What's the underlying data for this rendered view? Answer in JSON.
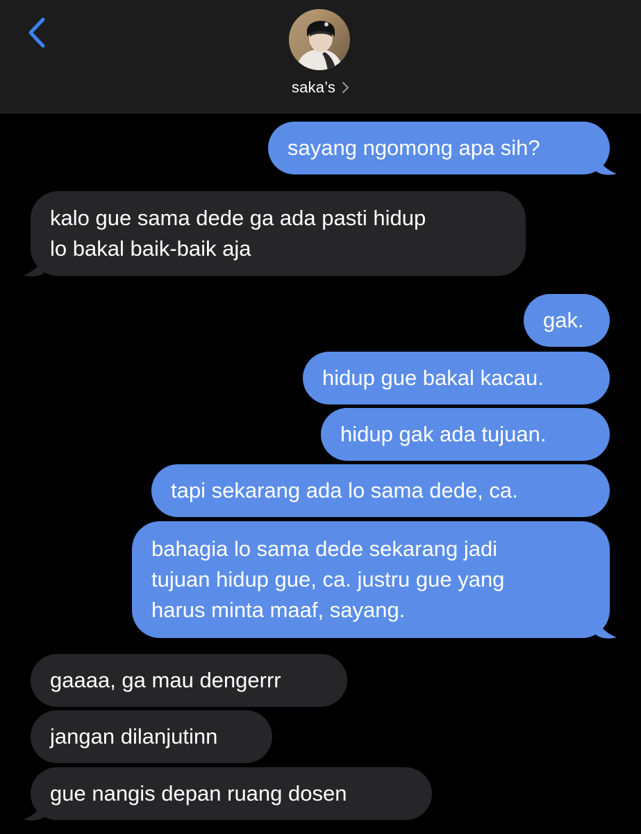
{
  "header": {
    "contact_name": "saka’s",
    "back_icon": "chevron-left-icon",
    "accent_color": "#5b8de8"
  },
  "messages": [
    {
      "direction": "outgoing",
      "lines": [
        "sayang ngomong apa sih?"
      ]
    },
    {
      "direction": "incoming",
      "lines": [
        "kalo gue sama dede ga ada pasti hidup",
        "lo bakal baik-baik aja"
      ]
    },
    {
      "direction": "outgoing",
      "lines": [
        "gak."
      ]
    },
    {
      "direction": "outgoing",
      "lines": [
        "hidup gue bakal kacau."
      ]
    },
    {
      "direction": "outgoing",
      "lines": [
        "hidup gak ada tujuan."
      ]
    },
    {
      "direction": "outgoing",
      "lines": [
        "tapi sekarang ada lo sama dede, ca."
      ]
    },
    {
      "direction": "outgoing",
      "lines": [
        "bahagia lo sama dede sekarang jadi",
        "tujuan hidup gue, ca. justru gue yang",
        "harus minta maaf, sayang."
      ]
    },
    {
      "direction": "incoming",
      "lines": [
        "gaaaa, ga mau dengerrr"
      ]
    },
    {
      "direction": "incoming",
      "lines": [
        "jangan dilanjutinn"
      ]
    },
    {
      "direction": "incoming",
      "lines": [
        "gue nangis depan ruang dosen"
      ]
    }
  ]
}
